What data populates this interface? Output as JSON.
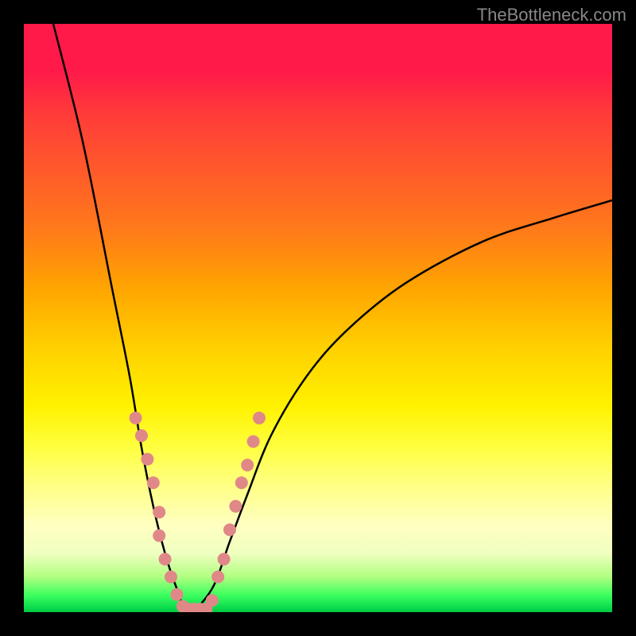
{
  "watermark": "TheBottleneck.com",
  "chart_data": {
    "type": "line",
    "title": "",
    "xlabel": "",
    "ylabel": "",
    "xlim": [
      0,
      100
    ],
    "ylim": [
      0,
      100
    ],
    "gradient_description": "vertical rainbow background: red (top, high bottleneck) → orange → yellow → green (bottom, low bottleneck)",
    "curve": {
      "description": "V-shaped black curve; single minimum near x≈28 touching y≈0, left arm starts at y≈100 at x≈5 and descends steeply, right arm rises toward y≈70 at x≈100",
      "left_arm": [
        {
          "x": 5,
          "y": 100
        },
        {
          "x": 10,
          "y": 80
        },
        {
          "x": 15,
          "y": 55
        },
        {
          "x": 18,
          "y": 40
        },
        {
          "x": 20,
          "y": 28
        },
        {
          "x": 22,
          "y": 18
        },
        {
          "x": 24,
          "y": 10
        },
        {
          "x": 26,
          "y": 4
        },
        {
          "x": 28,
          "y": 0
        }
      ],
      "right_arm": [
        {
          "x": 28,
          "y": 0
        },
        {
          "x": 32,
          "y": 4
        },
        {
          "x": 35,
          "y": 12
        },
        {
          "x": 38,
          "y": 20
        },
        {
          "x": 42,
          "y": 30
        },
        {
          "x": 48,
          "y": 40
        },
        {
          "x": 55,
          "y": 48
        },
        {
          "x": 65,
          "y": 56
        },
        {
          "x": 78,
          "y": 63
        },
        {
          "x": 90,
          "y": 67
        },
        {
          "x": 100,
          "y": 70
        }
      ]
    },
    "markers": {
      "description": "salmon-colored circular data points clustered near and around the curve minimum",
      "color": "#e08888",
      "points": [
        {
          "x": 19,
          "y": 33
        },
        {
          "x": 20,
          "y": 30
        },
        {
          "x": 21,
          "y": 26
        },
        {
          "x": 22,
          "y": 22
        },
        {
          "x": 23,
          "y": 17
        },
        {
          "x": 23,
          "y": 13
        },
        {
          "x": 24,
          "y": 9
        },
        {
          "x": 25,
          "y": 6
        },
        {
          "x": 26,
          "y": 3
        },
        {
          "x": 27,
          "y": 1
        },
        {
          "x": 28,
          "y": 0.5
        },
        {
          "x": 29,
          "y": 0.5
        },
        {
          "x": 30,
          "y": 0.5
        },
        {
          "x": 31,
          "y": 0.5
        },
        {
          "x": 32,
          "y": 2
        },
        {
          "x": 33,
          "y": 6
        },
        {
          "x": 34,
          "y": 9
        },
        {
          "x": 35,
          "y": 14
        },
        {
          "x": 36,
          "y": 18
        },
        {
          "x": 37,
          "y": 22
        },
        {
          "x": 38,
          "y": 25
        },
        {
          "x": 39,
          "y": 29
        },
        {
          "x": 40,
          "y": 33
        }
      ]
    }
  }
}
